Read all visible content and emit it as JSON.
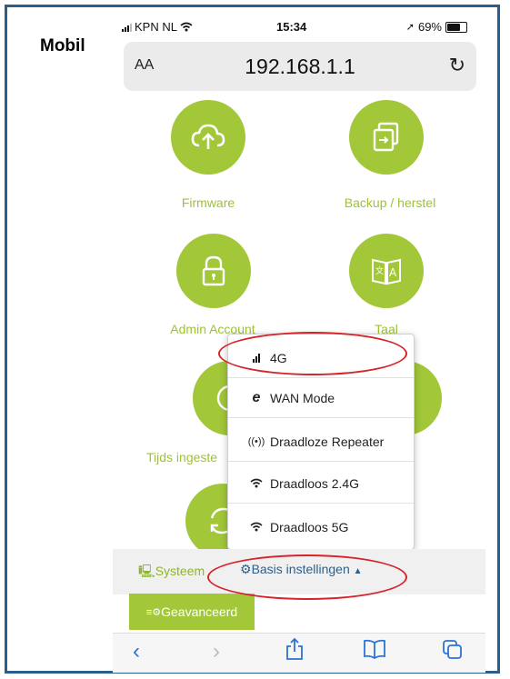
{
  "side_label": "Mobil",
  "status_bar": {
    "carrier": "KPN NL",
    "time": "15:34",
    "battery": "69%"
  },
  "url_bar": {
    "text_size": "AA",
    "url": "192.168.1.1"
  },
  "tiles": [
    {
      "label": "Firmware",
      "icon": "cloud-upload-icon"
    },
    {
      "label": "Backup / herstel",
      "icon": "copy-icon"
    },
    {
      "label": "Admin Account",
      "icon": "lock-icon"
    },
    {
      "label": "Taal",
      "icon": "translate-book-icon"
    },
    {
      "label": "Tijds ingeste",
      "icon": "clock-icon"
    },
    {
      "label": "",
      "icon": "refresh-icon"
    }
  ],
  "dropdown": {
    "items": [
      {
        "label": "4G",
        "icon": "signal-bars-icon"
      },
      {
        "label": "WAN Mode",
        "icon": "ie-icon"
      },
      {
        "label": "Draadloze Repeater",
        "icon": "antenna-icon"
      },
      {
        "label": "Draadloos 2.4G",
        "icon": "wifi-icon"
      },
      {
        "label": "Draadloos 5G",
        "icon": "wifi-icon"
      }
    ]
  },
  "tabs": {
    "systeem": "Systeem",
    "basis": "Basis instellingen",
    "geavanceerd": "Geavanceerd"
  },
  "colors": {
    "accent_green": "#a2c739",
    "label_green": "#9ec234",
    "link_blue": "#2e5f8a",
    "annotation_red": "#d6242a",
    "frame_blue": "#2b5d8c",
    "safari_blue": "#2a73d8"
  },
  "toolbar": [
    "back-icon",
    "forward-icon",
    "share-icon",
    "bookmarks-icon",
    "tabs-icon"
  ]
}
